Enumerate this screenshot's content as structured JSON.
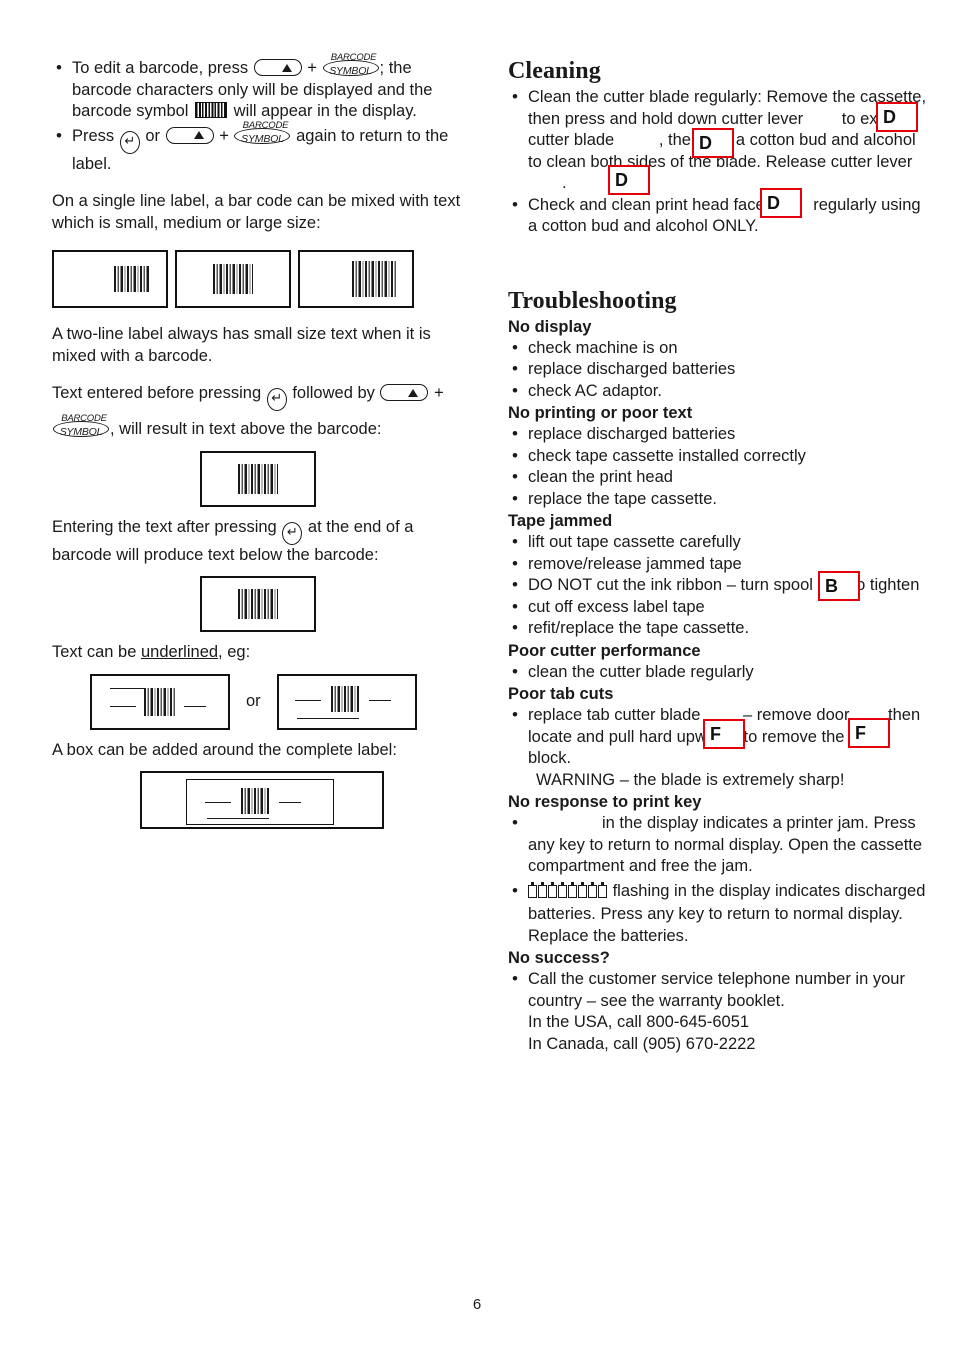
{
  "page": {
    "number": "6"
  },
  "left_column": {
    "bullets": [
      {
        "pre": "To edit a barcode, press",
        "mid": "+",
        "post": "; the barcode characters only will be displayed and the barcode symbol",
        "tail": "will appear in the display."
      },
      {
        "pre": "Press",
        "mid": "or",
        "plus": "+",
        "post": "again to return to the label."
      }
    ],
    "para_single_line": "On a single line label, a bar code can be mixed with text which is small, medium or large size:",
    "para_two_line": "A two-line label always has small size text when it is mixed with a barcode.",
    "para_text_before": {
      "part1": "Text entered before pressing",
      "part2": "followed by",
      "part3": "+",
      "part4": ", will result in text above the barcode:"
    },
    "para_text_after": {
      "part1": "Entering the text after pressing",
      "part2": "at the end of a barcode will produce text below the barcode:"
    },
    "para_underline": {
      "part1": "Text can be",
      "underlined": "underlined",
      "part2": ", eg:"
    },
    "or_label": "or",
    "para_box": "A box can be added around the complete label:"
  },
  "right_column": {
    "cleaning": {
      "heading": "Cleaning",
      "bullets": [
        {
          "segments": [
            "Clean the cutter blade regularly: Remove the cassette, then press and hold down cutter lever",
            "to expose cutter blade",
            ", then use a cotton bud and alcohol to clean both sides of the blade. Release cutter lever",
            "."
          ]
        },
        {
          "segments": [
            "Check and clean print head face",
            "regularly using a cotton bud and alcohol ONLY."
          ]
        }
      ]
    },
    "troubleshooting": {
      "heading": "Troubleshooting",
      "groups": [
        {
          "title": "No display",
          "items": [
            "check machine is on",
            "replace discharged batteries",
            "check AC adaptor."
          ]
        },
        {
          "title": "No printing or poor text",
          "items": [
            "replace discharged batteries",
            "check tape cassette installed correctly",
            "clean the print head",
            "replace the tape cassette."
          ]
        },
        {
          "title": "Tape jammed",
          "items": [
            "lift out tape cassette carefully",
            "remove/release jammed tape"
          ],
          "spool_item": {
            "pre": "DO NOT cut the ink ribbon – turn spool",
            "post": "to tighten"
          },
          "items_after": [
            "cut off excess label tape",
            "refit/replace the tape cassette."
          ]
        },
        {
          "title": "Poor cutter performance",
          "items": [
            "clean the cutter blade regularly"
          ]
        },
        {
          "title": "Poor tab cuts",
          "tab_item": {
            "pre": "replace tab cutter blade",
            "mid": "– remove door",
            "post": "then locate and pull hard upwards to remove the cutter block.",
            "warning": "WARNING – the blade is extremely sharp!"
          }
        },
        {
          "title": "No response to print key",
          "jam_item": {
            "post": "in the display indicates a printer jam. Press any key to return to normal display. Open the cassette compartment and free the jam."
          },
          "battery_item": {
            "post": "flashing in the display indicates discharged batteries. Press any key to return to normal display. Replace the batteries."
          }
        },
        {
          "title": "No success?",
          "items": [
            "Call the customer service telephone number in your country – see the warranty booklet."
          ],
          "phone_usa": "In the USA, call 800-645-6051",
          "phone_canada": "In Canada, call (905) 670-2222"
        }
      ]
    }
  },
  "annotations": {
    "cleaning_d1": "D",
    "cleaning_d2": "D",
    "cleaning_d3": "D",
    "cleaning_d4": "D",
    "spool_b": "B",
    "tab_f1": "F",
    "tab_f2": "F",
    "accent_red": "#e3000b"
  },
  "keys": {
    "shift_key": "shift-key",
    "enter_key": "enter-key",
    "barcode_top": "BARCODE",
    "barcode_mid": "SYMBOL"
  }
}
